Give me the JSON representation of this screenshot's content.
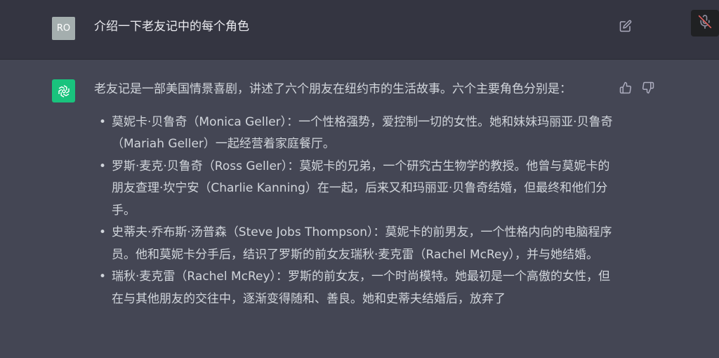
{
  "messages": [
    {
      "role": "user",
      "avatar": "RO",
      "text": "介绍一下老友记中的每个角色"
    },
    {
      "role": "assistant",
      "intro": "老友记是一部美国情景喜剧，讲述了六个朋友在纽约市的生活故事。六个主要角色分别是：",
      "bullets": [
        "莫妮卡·贝鲁奇（Monica Geller）：一个性格强势，爱控制一切的女性。她和妹妹玛丽亚·贝鲁奇（Mariah Geller）一起经营着家庭餐厅。",
        "罗斯·麦克·贝鲁奇（Ross Geller）：莫妮卡的兄弟，一个研究古生物学的教授。他曾与莫妮卡的朋友查理·坎宁安（Charlie Kanning）在一起，后来又和玛丽亚·贝鲁奇结婚，但最终和他们分手。",
        "史蒂夫·乔布斯·汤普森（Steve Jobs Thompson）：莫妮卡的前男友，一个性格内向的电脑程序员。他和莫妮卡分手后，结识了罗斯的前女友瑞秋·麦克雷（Rachel McRey），并与她结婚。",
        "瑞秋·麦克雷（Rachel McRey）：罗斯的前女友，一个时尚模特。她最初是一个高傲的女性，但在与其他朋友的交往中，逐渐变得随和、善良。她和史蒂夫结婚后，放弃了"
      ]
    }
  ],
  "icons": {
    "edit": "edit-icon",
    "thumbs_up": "thumbs-up-icon",
    "thumbs_down": "thumbs-down-icon",
    "mic_off": "mic-off-icon",
    "assistant_logo": "openai-logo-icon"
  },
  "colors": {
    "user_bg": "#343541",
    "assistant_bg": "#444654",
    "avatar_user_bg": "#a4aeae",
    "assistant_logo_bg": "#19c37d",
    "text": "#d1d5db"
  }
}
